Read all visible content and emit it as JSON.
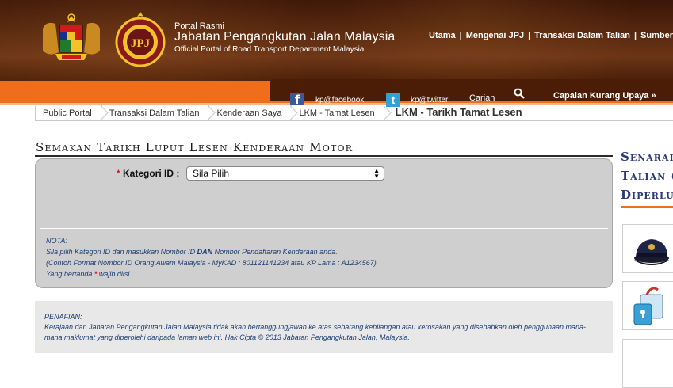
{
  "header": {
    "portal_rasmi": "Portal Rasmi",
    "title": "Jabatan Pengangkutan Jalan Malaysia",
    "subtitle": "Official Portal of Road Transport Department Malaysia",
    "jpj_logo_text": "JPJ",
    "nav": [
      "Utama",
      "Mengenai JPJ",
      "Transaksi Dalam Talian",
      "Sumber/Be"
    ]
  },
  "social": {
    "facebook_glyph": "f",
    "facebook_label": "kp@facebook",
    "twitter_glyph": "t",
    "twitter_label": "kp@twitter",
    "search_label": "Carian",
    "accessibility_label": "Capaian Kurang Upaya »"
  },
  "breadcrumb": [
    "Public Portal",
    "Transaksi Dalam Talian",
    "Kenderaan Saya",
    "LKM - Tamat Lesen",
    "LKM - Tarikh Tamat Lesen"
  ],
  "page": {
    "title": "Semakan Tarikh Luput Lesen Kenderaan Motor"
  },
  "form": {
    "required_star": "*",
    "kategori_label": "Kategori ID :",
    "kategori_selected": "Sila Pilih",
    "nota_title": "NOTA:",
    "nota_line1_pre": "Sila pilih Kategori ID dan masukkan Nombor ID ",
    "nota_line1_bold": "DAN",
    "nota_line1_post": " Nombor Pendaftaran Kenderaan anda.",
    "nota_line2": "(Contoh Format Nombor ID Orang Awam Malaysia - MyKAD : 801121141234 atau KP Lama : A1234567).",
    "nota_line3_pre": "Yang bertanda ",
    "nota_line3_star": "*",
    "nota_line3_post": " wajib diisi."
  },
  "disclaimer": {
    "title": "PENAFIAN:",
    "text": "Kerajaan dan Jabatan Pengangkutan Jalan Malaysia tidak akan bertanggungjawab ke atas sebarang kehilangan atau kerosakan yang disebabkan oleh penggunaan mana-mana maklumat yang diperolehi daripada laman web ini. Hak Cipta © 2013 Jabatan Pengangkutan Jalan, Malaysia."
  },
  "sidebar": {
    "title_line1": "Senarai",
    "title_line2": "Talian (",
    "title_line3": "Diperlu"
  },
  "colors": {
    "header_brown": "#5a2a10",
    "orange": "#ee6e1c",
    "panel_grey": "#cfcfcf",
    "note_blue": "#1c3d73",
    "sidebar_blue": "#2b3a7a"
  }
}
